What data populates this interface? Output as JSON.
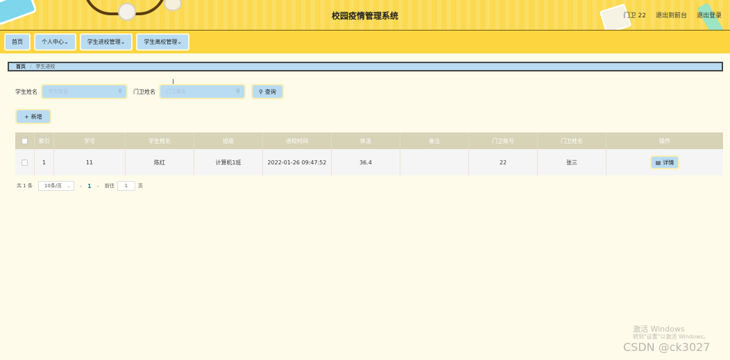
{
  "header": {
    "title": "校园疫情管理系统",
    "user_label": "门卫 22",
    "front_link": "退出到前台",
    "logout_link": "退出登录"
  },
  "nav": {
    "items": [
      {
        "label": "首页"
      },
      {
        "label": "个人中心"
      },
      {
        "label": "学生进校管理"
      },
      {
        "label": "学生离校管理"
      }
    ]
  },
  "breadcrumb": {
    "home": "首页",
    "separator": "/",
    "current": "学生进校"
  },
  "search": {
    "student_label": "学生姓名",
    "student_placeholder": "学生姓名",
    "guard_label": "门卫姓名",
    "guard_placeholder": "门卫姓名",
    "query_label": "查询"
  },
  "actions": {
    "add_label": "新增"
  },
  "table": {
    "columns": [
      "索引",
      "学号",
      "学生姓名",
      "班级",
      "进校时间",
      "体温",
      "备注",
      "门卫账号",
      "门卫姓名",
      "操作"
    ],
    "rows": [
      {
        "index": "1",
        "student_id": "11",
        "name": "陈红",
        "class": "计算机1班",
        "time": "2022-01-26 09:47:52",
        "temp": "36.4",
        "note": "",
        "guard_account": "22",
        "guard_name": "张三",
        "action": "详情"
      }
    ]
  },
  "pager": {
    "total": "共 1 条",
    "page_size": "10条/页",
    "current_page": "1",
    "goto_label": "前往",
    "goto_value": "1",
    "page_unit": "页"
  },
  "watermark": {
    "line1": "激活 Windows",
    "line2": "转到\"设置\"以激活 Windows。",
    "csdn": "CSDN @ck3027"
  },
  "colors": {
    "header_bg": "#fbd950",
    "accent_blue": "#b9dcf2",
    "page_bg": "#fefbea",
    "table_head": "#d6d3b6"
  }
}
